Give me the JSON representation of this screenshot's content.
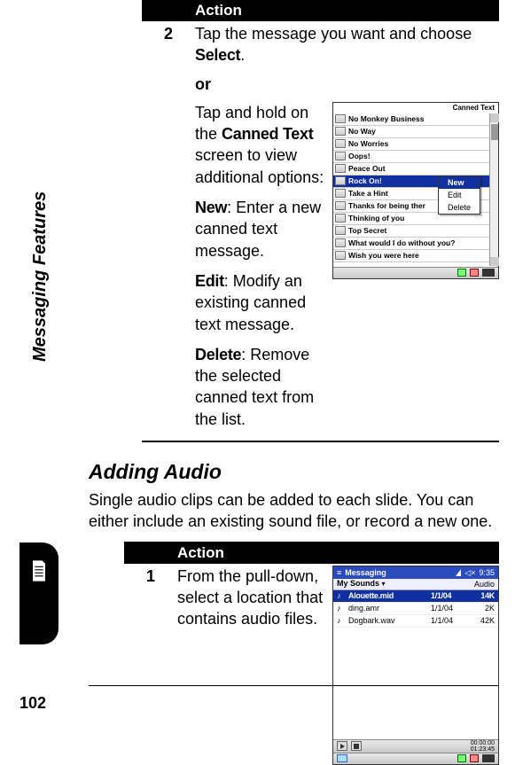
{
  "page_number": "102",
  "side_label": "Messaging Features",
  "table1": {
    "header": "Action",
    "step_num": "2",
    "step_text_a": "Tap the message you want and choose ",
    "step_text_select": "Select",
    "step_text_dot": ".",
    "or": "or",
    "hold_text_a": "Tap and hold on the ",
    "hold_text_key": "Canned Text",
    "hold_text_b": " screen to view additional options:",
    "opt_new_k": "New",
    "opt_new_v": ": Enter a new canned text message.",
    "opt_edit_k": "Edit",
    "opt_edit_v": ": Modify an existing canned text message.",
    "opt_del_k": "Delete",
    "opt_del_v": ": Remove the selected canned text from the list."
  },
  "canned": {
    "title": "Canned Text",
    "rows": [
      "No Monkey Business",
      "No Way",
      "No Worries",
      "Oops!",
      "Peace Out",
      "Rock On!",
      "Take a Hint",
      "Thanks for being ther",
      "Thinking of you",
      "Top Secret",
      "What would I do without you?",
      "Wish you were here"
    ],
    "selected_index": 5,
    "menu": [
      "New",
      "Edit",
      "Delete"
    ],
    "menu_selected": 0
  },
  "section_title": "Adding Audio",
  "section_text": "Single audio clips can be added to each slide. You can either include an existing sound file, or record a new one.",
  "table2": {
    "header": "Action",
    "step_num": "1",
    "step_text": "From the pull-down, select a location that contains audio files."
  },
  "audio": {
    "app_title": "Messaging",
    "clock": "9:35",
    "dropdown_label": "My Sounds",
    "dropdown_right": "Audio",
    "rows": [
      {
        "name": "Alouette.mid",
        "date": "1/1/04",
        "size": "14K",
        "sel": true
      },
      {
        "name": "ding.amr",
        "date": "1/1/04",
        "size": "2K",
        "sel": false
      },
      {
        "name": "Dogbark.wav",
        "date": "1/1/04",
        "size": "42K",
        "sel": false
      }
    ],
    "time1": "00:00:00",
    "time2": "01:23:45"
  }
}
